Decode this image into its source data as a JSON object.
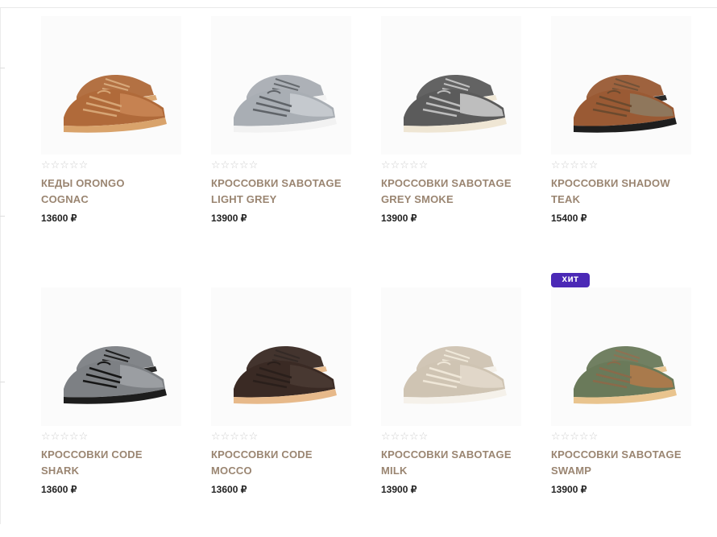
{
  "products": [
    {
      "name_line1": "КЕДЫ ORONGO",
      "name_line2": "COGNAC",
      "price": "13600 ₽",
      "rating": "☆☆☆☆☆",
      "badge": "",
      "colors": {
        "upper": "#b06a3a",
        "accent": "#c98554",
        "sole": "#d9a36b",
        "lace": "#d6a575"
      }
    },
    {
      "name_line1": "КРОССОВКИ SABOTAGE",
      "name_line2": "LIGHT GREY",
      "price": "13900 ₽",
      "rating": "☆☆☆☆☆",
      "badge": "",
      "colors": {
        "upper": "#a9aeb4",
        "accent": "#c8ccd0",
        "sole": "#f2f2f2",
        "lace": "#5f6368"
      }
    },
    {
      "name_line1": "КРОССОВКИ SABOTAGE",
      "name_line2": "GREY SMOKE",
      "price": "13900 ₽",
      "rating": "☆☆☆☆☆",
      "badge": "",
      "colors": {
        "upper": "#5b5b5b",
        "accent": "#c9c9c9",
        "sole": "#efe6d4",
        "lace": "#bdbdbd"
      }
    },
    {
      "name_line1": "КРОССОВКИ SHADOW",
      "name_line2": "TEAK",
      "price": "15400 ₽",
      "rating": "☆☆☆☆☆",
      "badge": "",
      "colors": {
        "upper": "#9a5a34",
        "accent": "#8e7a60",
        "sole": "#1e1e1e",
        "lace": "#6b4a2e"
      }
    },
    {
      "name_line1": "КРОССОВКИ CODE",
      "name_line2": "SHARK",
      "price": "13600 ₽",
      "rating": "☆☆☆☆☆",
      "badge": "",
      "colors": {
        "upper": "#7d8084",
        "accent": "#9ea1a5",
        "sole": "#1d1d1d",
        "lace": "#151515"
      }
    },
    {
      "name_line1": "КРОССОВКИ CODE",
      "name_line2": "MOCCO",
      "price": "13600 ₽",
      "rating": "☆☆☆☆☆",
      "badge": "",
      "colors": {
        "upper": "#3a2a24",
        "accent": "#4a3a33",
        "sole": "#e7b98a",
        "lace": "#2a1f1b"
      }
    },
    {
      "name_line1": "КРОССОВКИ SABOTAGE",
      "name_line2": "MILK",
      "price": "13900 ₽",
      "rating": "☆☆☆☆☆",
      "badge": "",
      "colors": {
        "upper": "#cfc4b3",
        "accent": "#e2d9cb",
        "sole": "#f5f1ea",
        "lace": "#efe7d8"
      }
    },
    {
      "name_line1": "КРОССОВКИ SABOTAGE",
      "name_line2": "SWAMP",
      "price": "13900 ₽",
      "rating": "☆☆☆☆☆",
      "badge": "ХИТ",
      "colors": {
        "upper": "#6a7a5a",
        "accent": "#b07a4a",
        "sole": "#e9c48e",
        "lace": "#8a6a4a"
      }
    }
  ]
}
